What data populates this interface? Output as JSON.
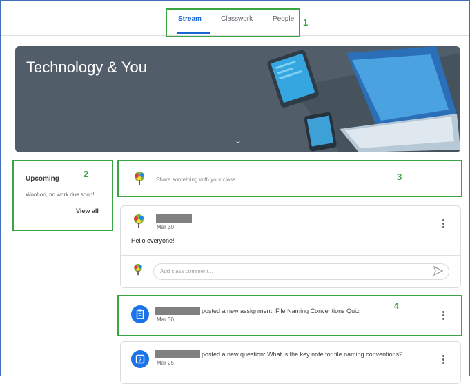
{
  "tabs": [
    {
      "label": "Stream"
    },
    {
      "label": "Classwork"
    },
    {
      "label": "People"
    }
  ],
  "callouts": [
    "1",
    "2",
    "3",
    "4"
  ],
  "banner": {
    "title": "Technology & You"
  },
  "upcoming": {
    "title": "Upcoming",
    "text": "Woohoo, no work due soon!",
    "link": "View all"
  },
  "share": {
    "placeholder": "Share something with your class..."
  },
  "post1": {
    "date": "Mar 30",
    "text": "Hello everyone!",
    "comment_placeholder": "Add class comment..."
  },
  "post2": {
    "text": "posted a new assignment: File Naming Conventions Quiz",
    "date": "Mar 30"
  },
  "post3": {
    "text": "posted a new question: What is the key note for file naming conventions?",
    "date": "Mar 25"
  },
  "colors": {
    "accent": "#1967d2",
    "callout": "#3aa543",
    "banner": "#515e6a",
    "frame": "#3f6fb6"
  }
}
